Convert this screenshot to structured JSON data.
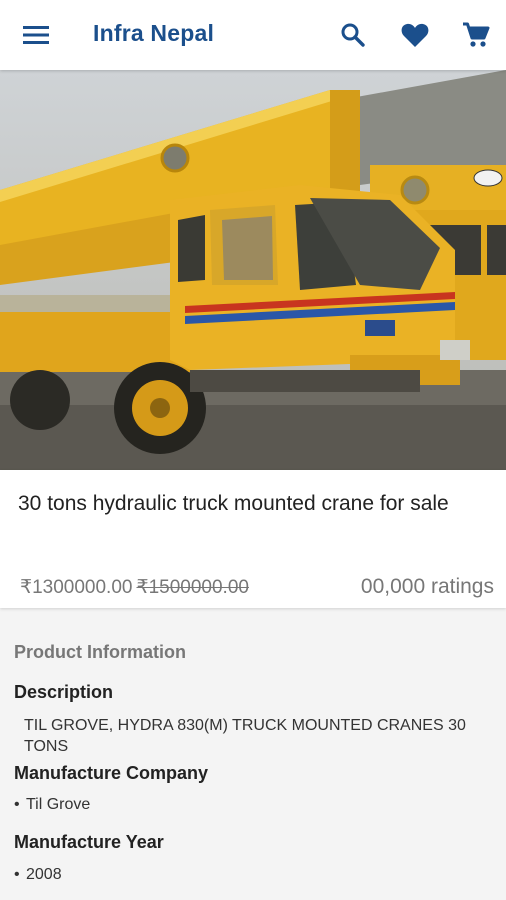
{
  "app": {
    "title": "Infra Nepal"
  },
  "icons": {
    "menu": "menu-icon",
    "search": "search-icon",
    "favorite": "heart-icon",
    "cart": "shopping-cart-icon",
    "accent_color": "#1b4f8c"
  },
  "product": {
    "title": "30 tons hydraulic truck mounted crane for sale",
    "price": "₹1300000.00",
    "old_price": "₹1500000.00",
    "ratings": "00,000 ratings"
  },
  "info": {
    "heading": "Product Information",
    "description_label": "Description",
    "description": "TIL GROVE, HYDRA 830(M) TRUCK MOUNTED CRANES 30 TONS",
    "manufacturer_label": "Manufacture Company",
    "manufacturer_bullet": "•",
    "manufacturer": "Til Grove",
    "year_label": "Manufacture Year",
    "year_bullet": "•",
    "year": "2008"
  }
}
